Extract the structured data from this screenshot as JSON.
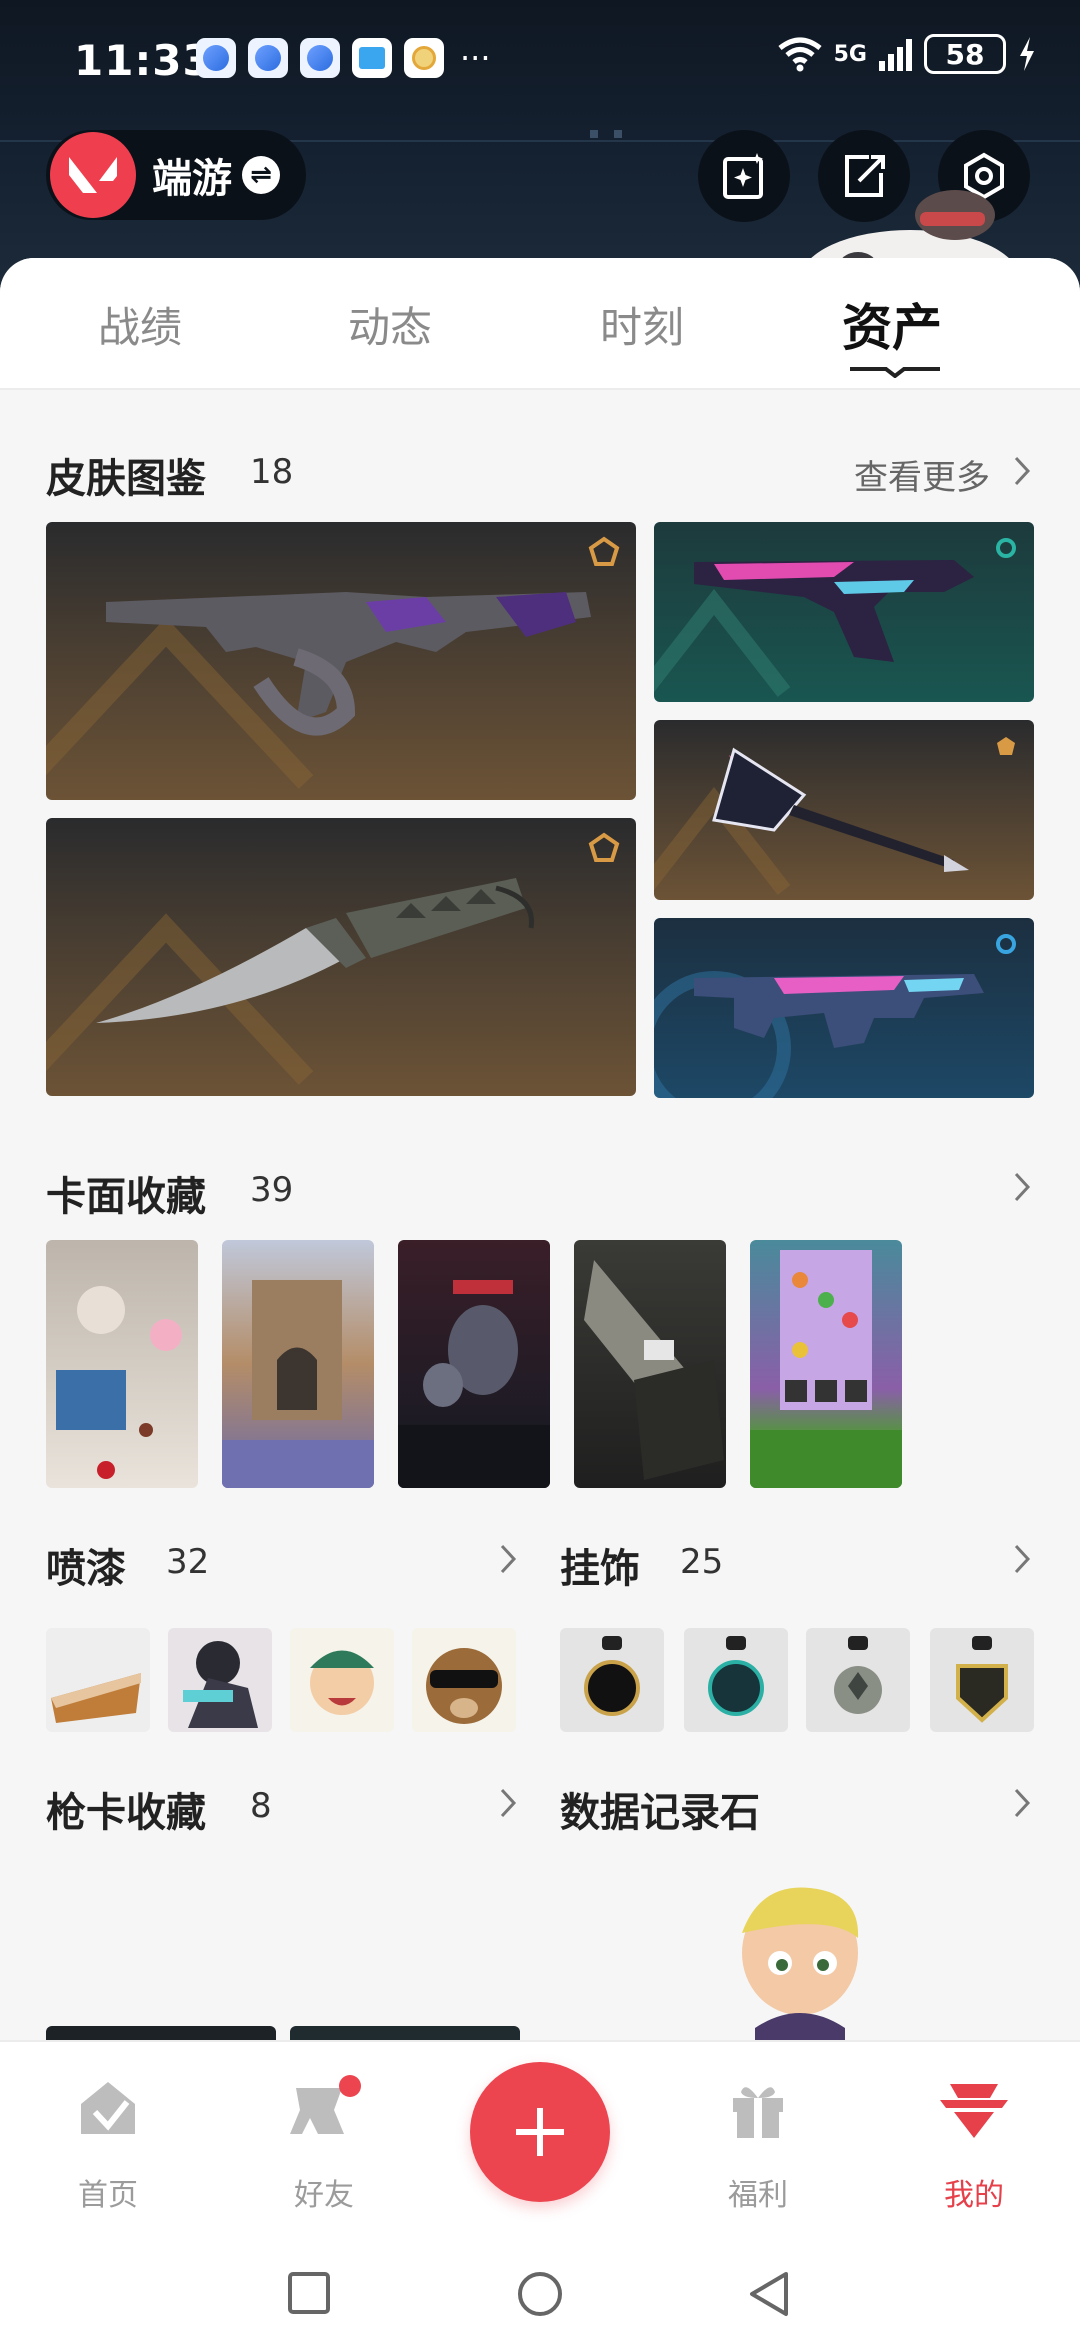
{
  "status_bar": {
    "time": "11:33",
    "network": "5G",
    "battery": "58"
  },
  "header": {
    "user_name": "端游"
  },
  "tabs": [
    {
      "label": "战绩"
    },
    {
      "label": "动态"
    },
    {
      "label": "时刻"
    },
    {
      "label": "资产"
    }
  ],
  "active_tab": "资产",
  "skins": {
    "title": "皮肤图鉴",
    "count": "18",
    "more": "查看更多"
  },
  "cards": {
    "title": "卡面收藏",
    "count": "39"
  },
  "sprays": {
    "title": "喷漆",
    "count": "32"
  },
  "buddies": {
    "title": "挂饰",
    "count": "25"
  },
  "gun_cards": {
    "title": "枪卡收藏",
    "count": "8"
  },
  "data_stone": {
    "title": "数据记录石"
  },
  "bottom_nav": [
    {
      "label": "首页"
    },
    {
      "label": "好友"
    },
    {
      "label": "福利"
    },
    {
      "label": "我的"
    }
  ],
  "colors": {
    "accent": "#ec4550",
    "active_nav": "#e6404b"
  }
}
